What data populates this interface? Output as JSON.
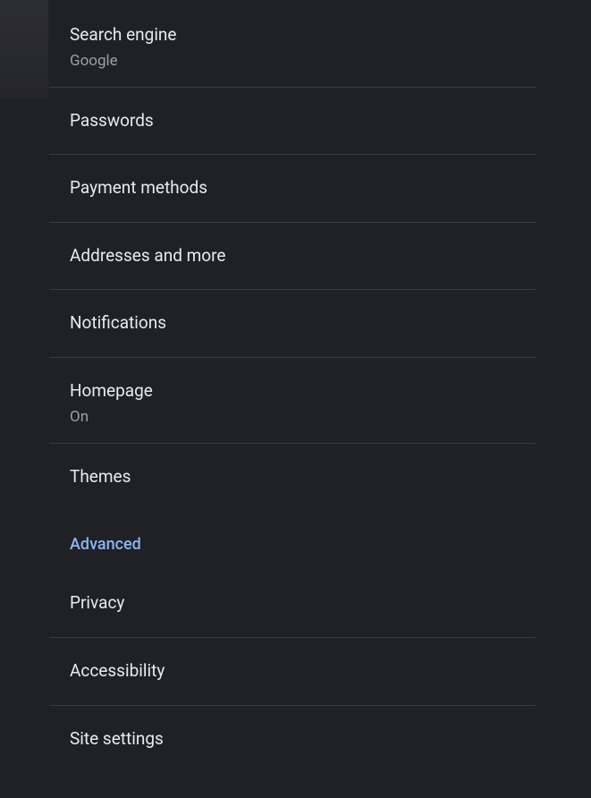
{
  "settings": {
    "items": [
      {
        "title": "Search engine",
        "subtitle": "Google"
      },
      {
        "title": "Passwords"
      },
      {
        "title": "Payment methods"
      },
      {
        "title": "Addresses and more"
      },
      {
        "title": "Notifications"
      },
      {
        "title": "Homepage",
        "subtitle": "On"
      },
      {
        "title": "Themes"
      }
    ],
    "section_header": "Advanced",
    "advanced_items": [
      {
        "title": "Privacy"
      },
      {
        "title": "Accessibility"
      },
      {
        "title": "Site settings"
      }
    ]
  }
}
